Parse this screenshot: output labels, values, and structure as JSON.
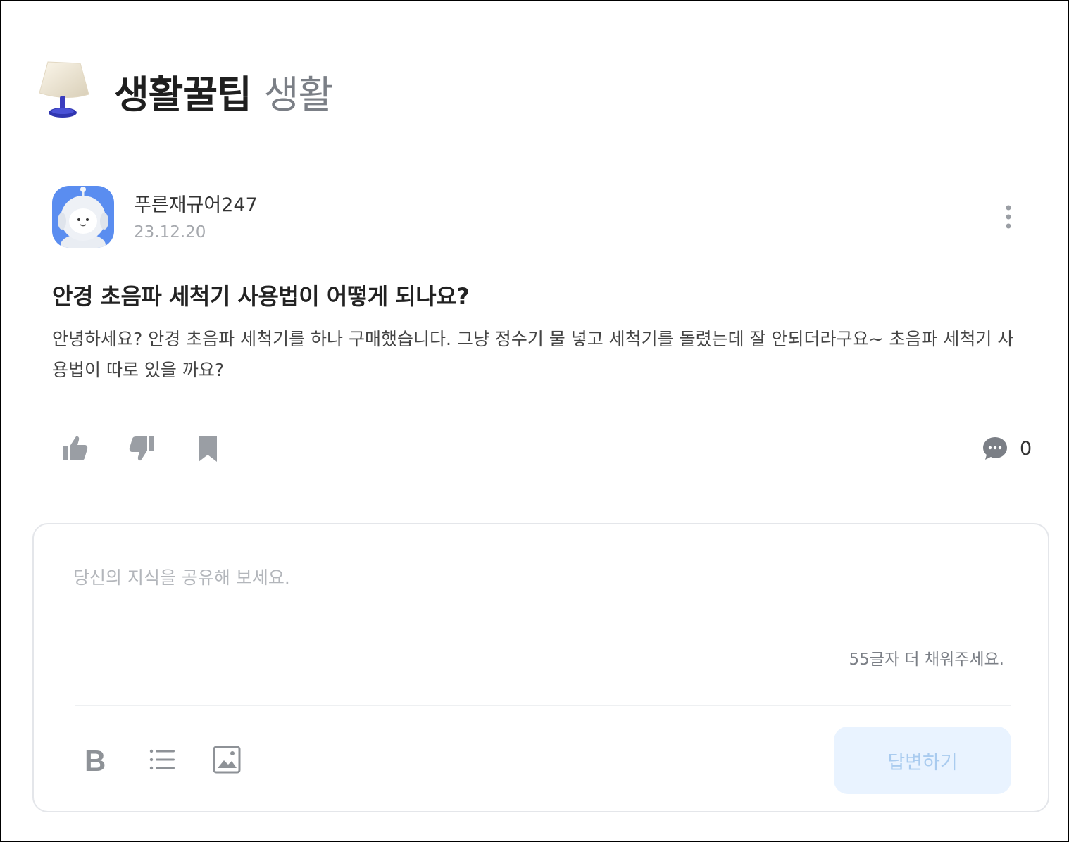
{
  "category": {
    "title": "생활꿀팁",
    "subtitle": "생활",
    "icon": "lamp-icon"
  },
  "author": {
    "name": "푸른재규어247",
    "date": "23.12.20",
    "avatar_icon": "astronaut-avatar"
  },
  "question": {
    "title": "안경 초음파 세척기 사용법이 어떻게 되나요?",
    "body": "안녕하세요? 안경 초음파 세척기를 하나 구매했습니다. 그냥 정수기 물 넣고 세척기를 돌렸는데 잘 안되더라구요~ 초음파 세척기 사용법이 따로 있을 까요?"
  },
  "actions": {
    "like_icon": "thumbs-up-icon",
    "dislike_icon": "thumbs-down-icon",
    "bookmark_icon": "bookmark-icon",
    "comment_icon": "comment-bubble-icon",
    "comment_count": "0"
  },
  "answer": {
    "placeholder": "당신의 지식을 공유해 보세요.",
    "char_hint": "55글자 더 채워주세요.",
    "submit_label": "답변하기",
    "tools": [
      "bold-icon",
      "list-icon",
      "image-icon"
    ]
  },
  "colors": {
    "accent_light": "#e9f3ff",
    "accent_text": "#a9cbef",
    "avatar_bg": "#5a8df0",
    "icon_gray": "#9a9ea4"
  }
}
